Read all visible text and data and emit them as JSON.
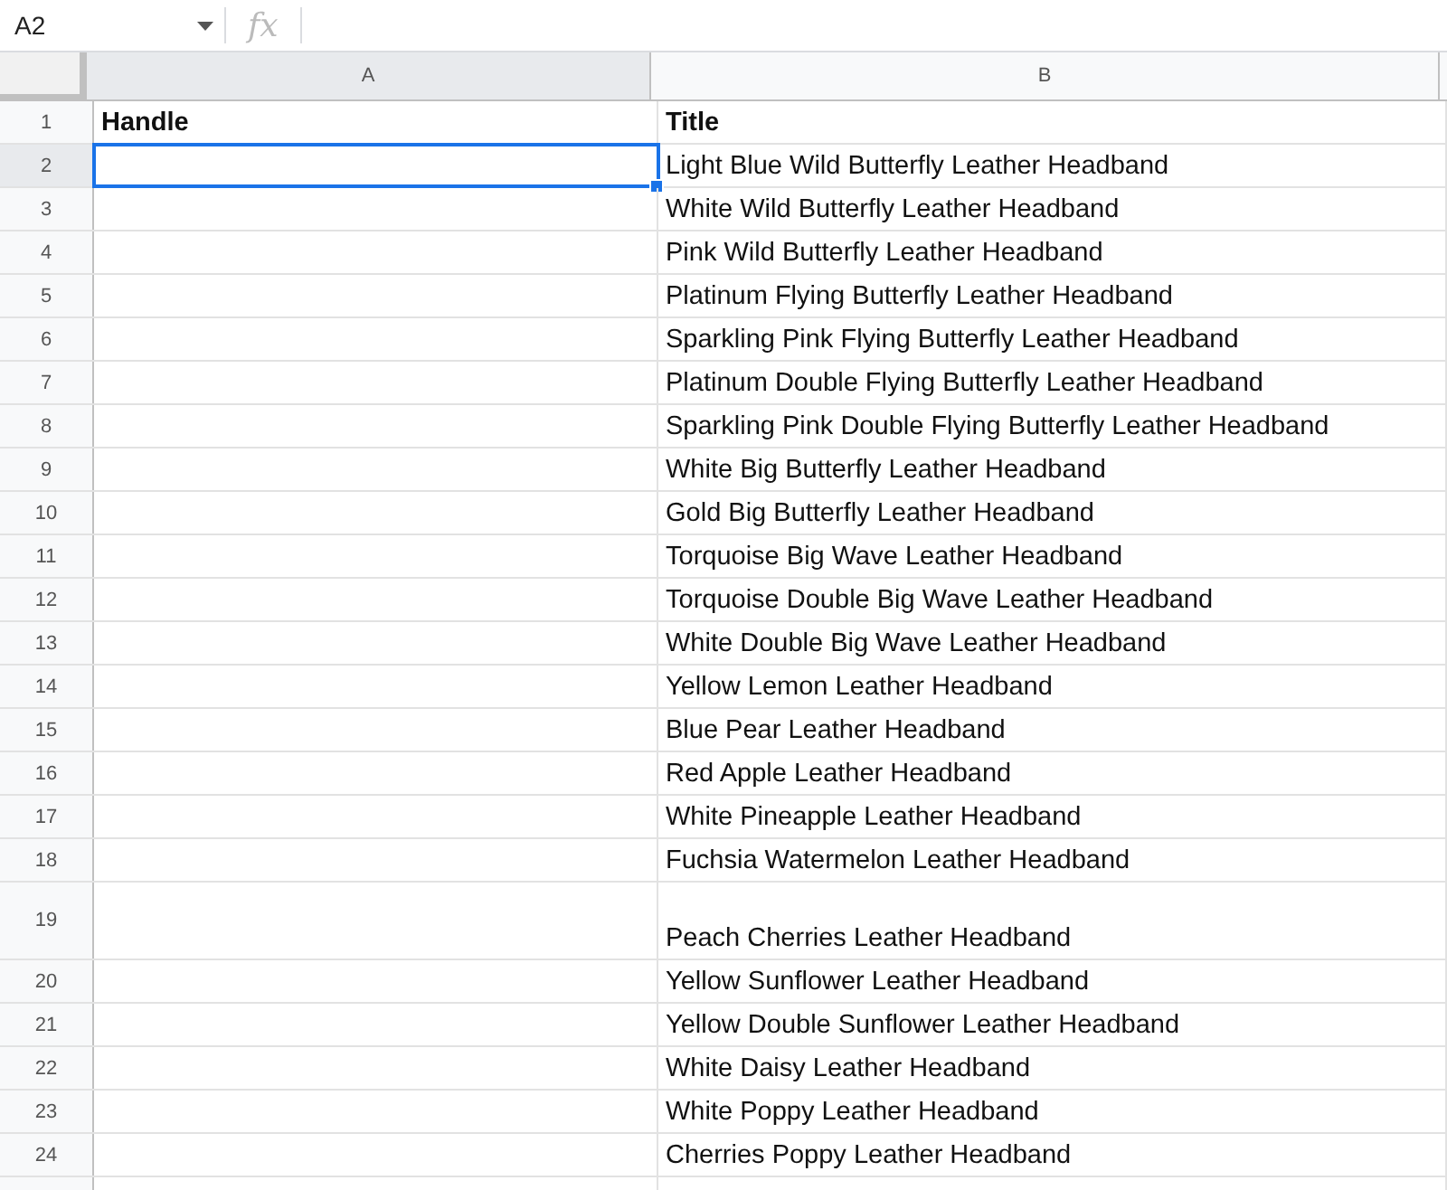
{
  "formula_bar": {
    "cell_ref": "A2",
    "fx": "fx"
  },
  "columns": [
    "A",
    "B"
  ],
  "rows": [
    {
      "number": "1",
      "handle": "Handle",
      "title": "Title",
      "kind": "bold",
      "selected": false
    },
    {
      "number": "2",
      "title": "Light Blue Wild Butterfly Leather Headband",
      "kind": "normal",
      "selected": true
    },
    {
      "number": "3",
      "title": "White Wild Butterfly Leather Headband",
      "kind": "normal",
      "selected": false
    },
    {
      "number": "4",
      "title": "Pink Wild Butterfly Leather Headband",
      "kind": "normal",
      "selected": false
    },
    {
      "number": "5",
      "title": "Platinum Flying Butterfly Leather Headband",
      "kind": "normal",
      "selected": false
    },
    {
      "number": "6",
      "title": "Sparkling Pink Flying Butterfly Leather Headband",
      "kind": "normal",
      "selected": false
    },
    {
      "number": "7",
      "title": "Platinum Double Flying Butterfly Leather Headband",
      "kind": "normal",
      "selected": false
    },
    {
      "number": "8",
      "title": "Sparkling Pink Double Flying Butterfly Leather Headband",
      "kind": "normal",
      "selected": false
    },
    {
      "number": "9",
      "title": "White Big Butterfly Leather Headband",
      "kind": "normal",
      "selected": false
    },
    {
      "number": "10",
      "title": "Gold Big Butterfly Leather Headband",
      "kind": "normal",
      "selected": false
    },
    {
      "number": "11",
      "title": "Torquoise Big Wave Leather Headband",
      "kind": "normal",
      "selected": false
    },
    {
      "number": "12",
      "title": "Torquoise Double Big Wave Leather Headband",
      "kind": "normal",
      "selected": false
    },
    {
      "number": "13",
      "title": "White Double Big Wave Leather Headband",
      "kind": "normal",
      "selected": false
    },
    {
      "number": "14",
      "title": "Yellow Lemon Leather Headband",
      "kind": "normal",
      "selected": false
    },
    {
      "number": "15",
      "title": "Blue Pear Leather Headband",
      "kind": "normal",
      "selected": false
    },
    {
      "number": "16",
      "title": "Red Apple Leather Headband",
      "kind": "normal",
      "selected": false
    },
    {
      "number": "17",
      "title": "White Pineapple Leather Headband",
      "kind": "normal",
      "selected": false
    },
    {
      "number": "18",
      "title": "Fuchsia Watermelon Leather Headband",
      "kind": "normal",
      "selected": false
    },
    {
      "number": "19",
      "title": "Peach Cherries Leather Headband",
      "kind": "tall",
      "selected": false
    },
    {
      "number": "20",
      "title": "Yellow Sunflower Leather Headband",
      "kind": "normal",
      "selected": false
    },
    {
      "number": "21",
      "title": "Yellow Double Sunflower Leather Headband",
      "kind": "normal",
      "selected": false
    },
    {
      "number": "22",
      "title": "White Daisy Leather Headband",
      "kind": "normal",
      "selected": false
    },
    {
      "number": "23",
      "title": "White Poppy  Leather Headband",
      "kind": "normal",
      "selected": false
    },
    {
      "number": "24",
      "title": "Cherries Poppy  Leather Headband",
      "kind": "normal",
      "selected": false
    }
  ]
}
